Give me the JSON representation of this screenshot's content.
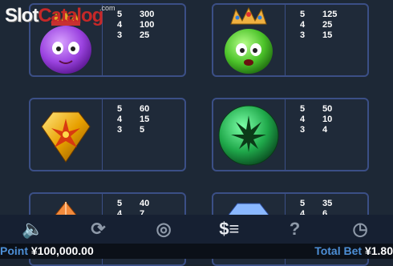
{
  "logo": {
    "slot": "Slot",
    "catalog": "Catalog",
    "com": ".com"
  },
  "paytable": [
    {
      "icon": "purple-crowned-blob",
      "pays": [
        {
          "count": "5",
          "value": "300"
        },
        {
          "count": "4",
          "value": "100"
        },
        {
          "count": "3",
          "value": "25"
        }
      ]
    },
    {
      "icon": "green-crowned-blob",
      "pays": [
        {
          "count": "5",
          "value": "125"
        },
        {
          "count": "4",
          "value": "25"
        },
        {
          "count": "3",
          "value": "15"
        }
      ]
    },
    {
      "icon": "yellow-diamond",
      "pays": [
        {
          "count": "5",
          "value": "60"
        },
        {
          "count": "4",
          "value": "15"
        },
        {
          "count": "3",
          "value": "5"
        }
      ]
    },
    {
      "icon": "green-round-gem",
      "pays": [
        {
          "count": "5",
          "value": "50"
        },
        {
          "count": "4",
          "value": "10"
        },
        {
          "count": "3",
          "value": "4"
        }
      ]
    },
    {
      "icon": "orange-gem",
      "pays": [
        {
          "count": "5",
          "value": "40"
        },
        {
          "count": "4",
          "value": "7"
        }
      ]
    },
    {
      "icon": "blue-gem",
      "pays": [
        {
          "count": "5",
          "value": "35"
        },
        {
          "count": "4",
          "value": "6"
        }
      ]
    }
  ],
  "toolbar": {
    "buttons": [
      {
        "icon": "speaker-icon",
        "glyph": "🔈"
      },
      {
        "icon": "autoplay-icon",
        "glyph": "⟳"
      },
      {
        "icon": "chips-icon",
        "glyph": "◎"
      },
      {
        "icon": "paytable-icon",
        "glyph": "$≡"
      },
      {
        "icon": "help-icon",
        "glyph": "?"
      },
      {
        "icon": "history-icon",
        "glyph": "◷"
      }
    ]
  },
  "status": {
    "point_label": "Point",
    "point_value": "¥100,000.00",
    "total_bet_label": "Total Bet",
    "total_bet_value": "¥1.80"
  },
  "colors": {
    "card_border": "#3b4f86",
    "background": "#1d2836",
    "accent": "#4d8fd6"
  }
}
